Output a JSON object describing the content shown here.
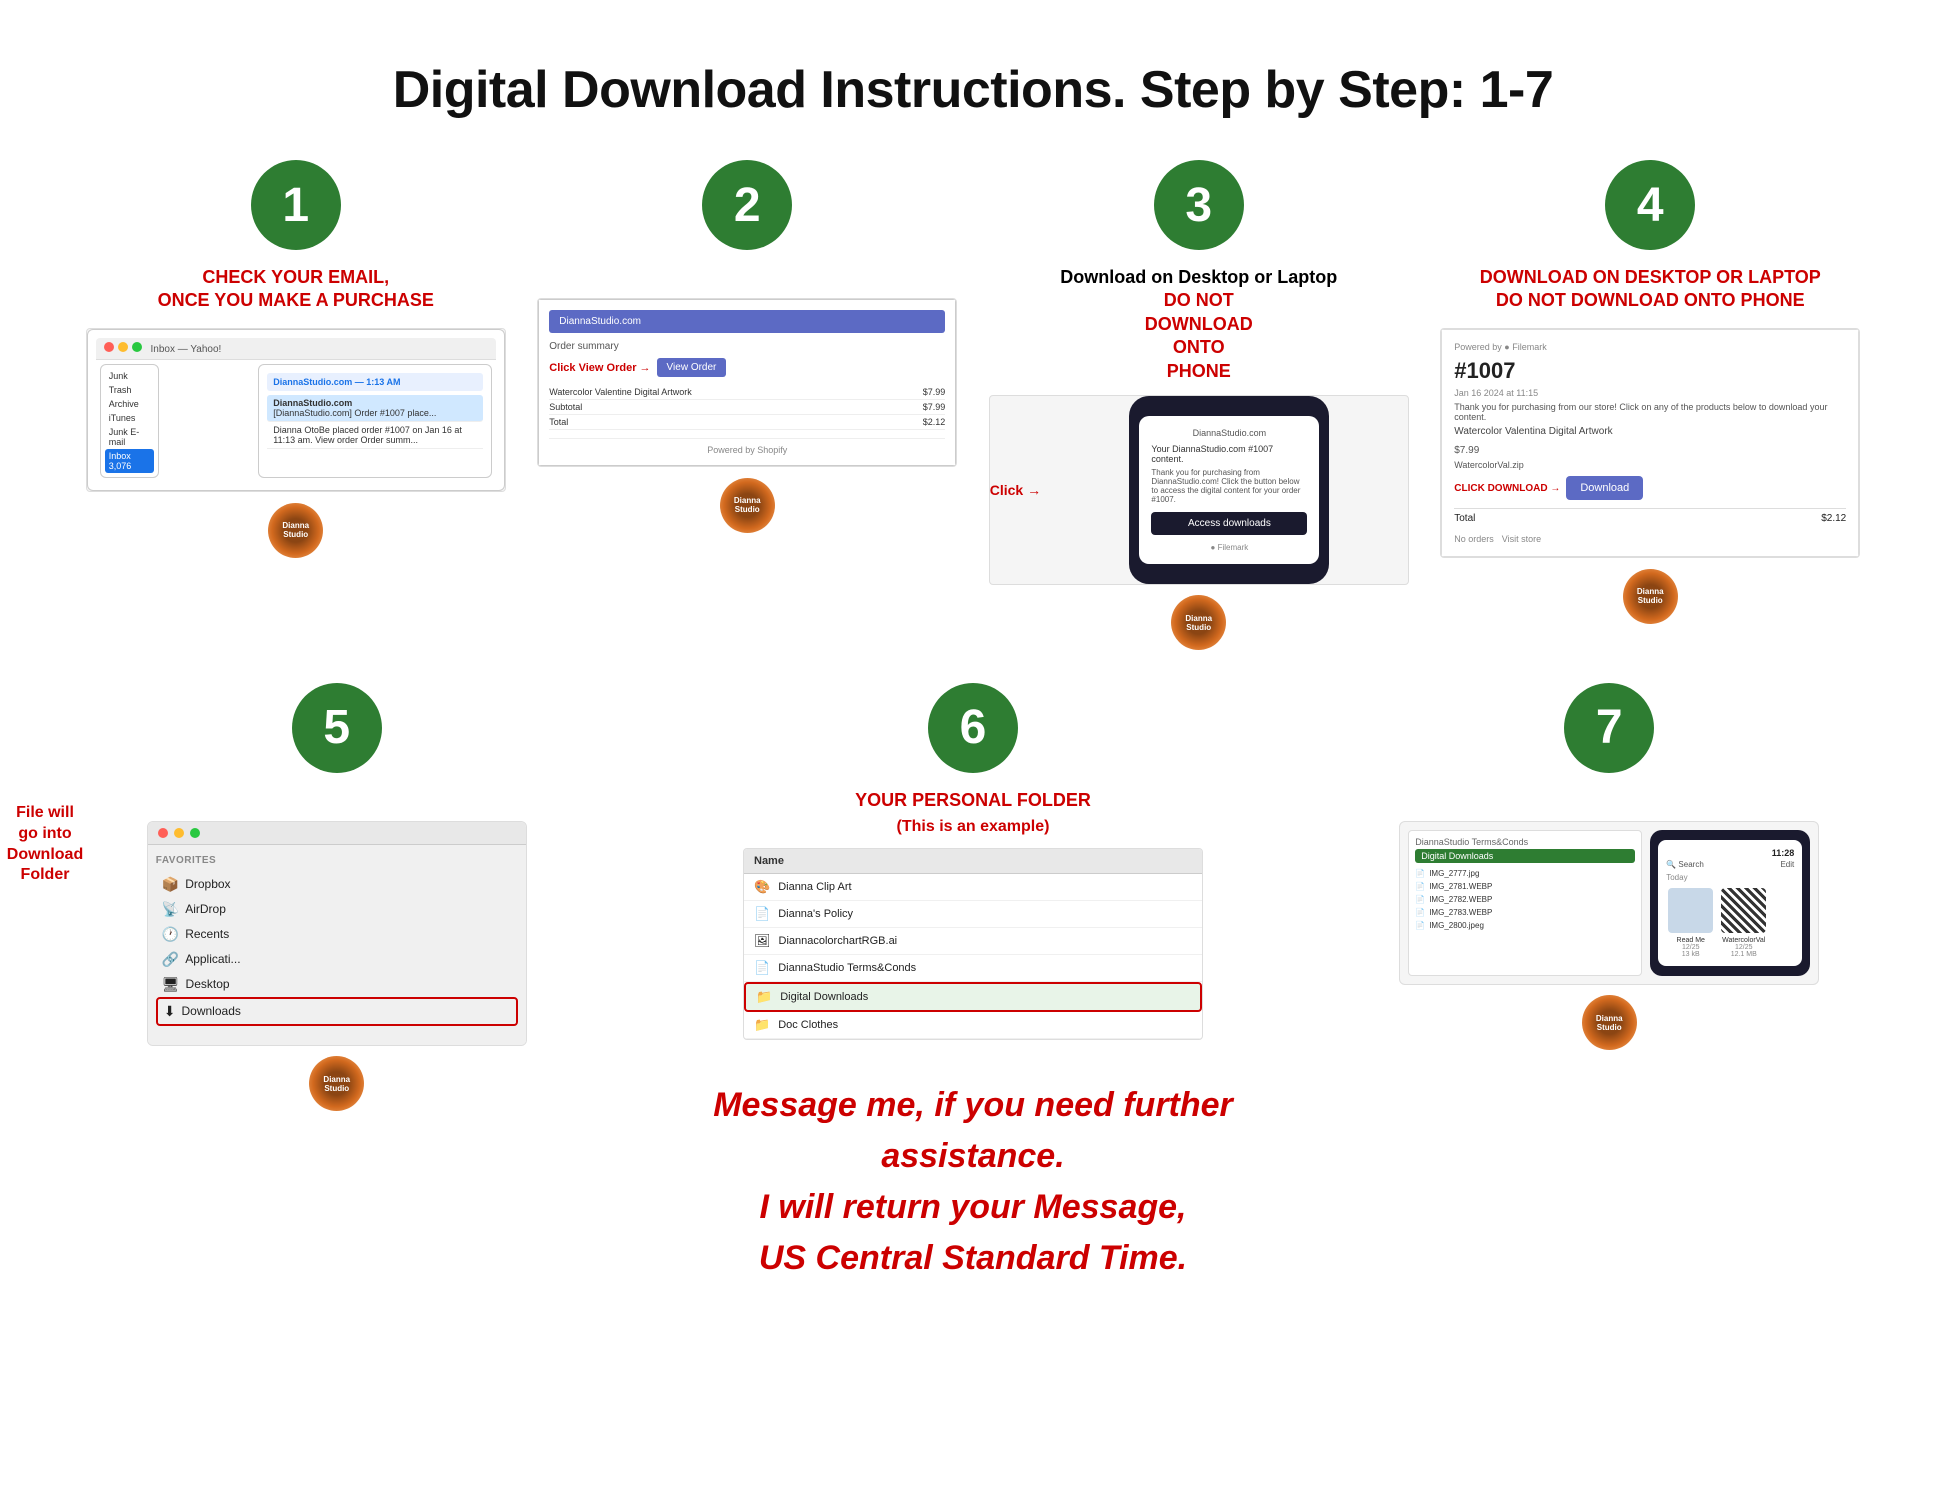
{
  "page": {
    "title": "Digital Download Instructions. Step by Step: 1-7"
  },
  "steps": [
    {
      "number": "1",
      "label": "CHECK YOUR EMAIL,\nONCE YOU MAKE A PURCHASE",
      "sidebar_items": [
        "Junk",
        "Trash",
        "Archive",
        "iTunes",
        "Junk E-mail"
      ],
      "inbox_count": "3,076",
      "email_sender": "DiannaStudio.com",
      "email_subject": "Order #1007",
      "email_preview": "[DiannaStudio.com] Order #1007 place...",
      "email_date": "1:13 AM"
    },
    {
      "number": "2",
      "label": "",
      "arrow_text": "Click View Order",
      "view_order_label": "View Order"
    },
    {
      "number": "3",
      "label": "Download on Desktop or Laptop\nDO NOT DOWNLOAD ONTO PHONE",
      "click_text": "Click",
      "access_btn": "Access downloads",
      "phone_site": "DiannaStudio.com",
      "order_ref": "#1007 content"
    },
    {
      "number": "4",
      "label": "DOWNLOAD ON DESKTOP OR LAPTOP\nDO NOT DOWNLOAD ONTO PHONE",
      "order_number": "#1007",
      "product": "Watercolor Valentina Digital Artwork",
      "price": "$7.99",
      "file_name": "WatercolorVal.zip",
      "download_btn": "Download",
      "click_download": "CLICK DOWNLOAD",
      "total_label": "Total",
      "total_value": "$2.12"
    },
    {
      "number": "5",
      "left_text": "File will\ngo into\nDownload\nFolder",
      "favorites_title": "Favorites",
      "finder_items": [
        {
          "icon": "📦",
          "label": "Dropbox"
        },
        {
          "icon": "📡",
          "label": "AirDrop"
        },
        {
          "icon": "🕐",
          "label": "Recents"
        },
        {
          "icon": "🔗",
          "label": "Applicati..."
        },
        {
          "icon": "🖥",
          "label": "Desktop"
        },
        {
          "icon": "⬇",
          "label": "Downloads",
          "highlighted": true
        }
      ]
    },
    {
      "number": "6",
      "label": "YOUR PERSONAL FOLDER",
      "sublabel": "(This is an example)",
      "folder_name_col": "Name",
      "folder_items": [
        {
          "icon": "🎨",
          "label": "Dianna Clip Art"
        },
        {
          "icon": "📄",
          "label": "Dianna's Policy"
        },
        {
          "icon": "🖼",
          "label": "DiannacolorchartRGB.ai"
        },
        {
          "icon": "📄",
          "label": "DiannaStudio Terms&Conds"
        },
        {
          "icon": "📁",
          "label": "Digital Downloads",
          "highlighted": true
        },
        {
          "icon": "📁",
          "label": "Doc Clothes"
        }
      ]
    },
    {
      "number": "7",
      "folder_name": "Digital Downloads",
      "files": [
        "IMG_2777.jpg",
        "IMG_2781.WEBP",
        "IMG_2782.WEBP",
        "IMG_2783.WEBP",
        "IMG_2800.jpeg"
      ],
      "phone_time": "11:28",
      "phone_date": "Today",
      "thumb_labels": [
        "Read Me",
        "WatercolorVal"
      ],
      "thumb_dates": [
        "12/25",
        "12/25"
      ],
      "thumb_sizes": [
        "13 kB",
        "12.1 MB"
      ]
    }
  ],
  "bottom_message": {
    "line1": "Message me, if you need further assistance.",
    "line2": "I will return your Message,",
    "line3": "US Central Standard Time."
  }
}
